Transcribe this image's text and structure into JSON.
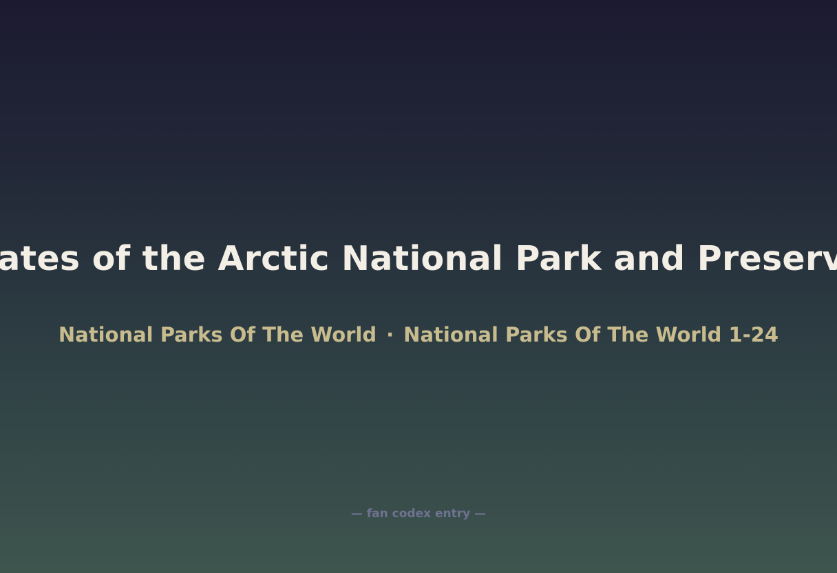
{
  "card": {
    "title": "Gates of the Arctic National Park and Preserve",
    "series": "National Parks Of The World",
    "separator": "·",
    "set": "National Parks Of The World 1-24",
    "footer": "— fan codex entry —"
  },
  "colors": {
    "title": "#f3efe6",
    "subtitle": "#c8bc8f",
    "footer": "#6f7290",
    "background_top": "#1c1a31",
    "background_bottom": "#3e554e"
  }
}
